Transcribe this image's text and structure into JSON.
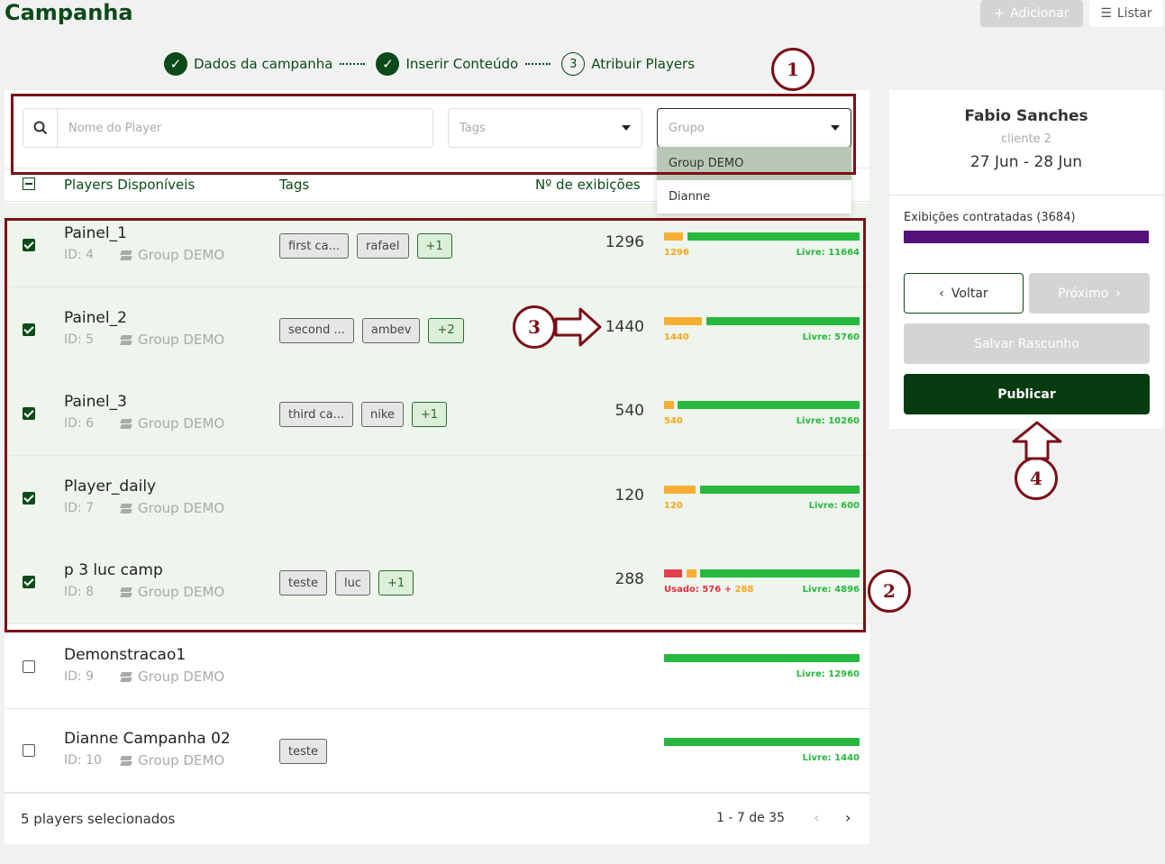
{
  "page_title": "Campanha",
  "top_actions": {
    "add_label": "Adicionar",
    "list_label": "Listar"
  },
  "stepper": [
    {
      "label": "Dados da campanha",
      "state": "done"
    },
    {
      "label": "Inserir Conteúdo",
      "state": "done"
    },
    {
      "label": "Atribuir Players",
      "state": "current",
      "number": "3"
    }
  ],
  "filters": {
    "search_placeholder": "Nome do Player",
    "tags_placeholder": "Tags",
    "group_placeholder": "Grupo",
    "group_options": [
      "Group DEMO",
      "Dianne"
    ]
  },
  "table": {
    "headers": {
      "players": "Players Disponíveis",
      "tags": "Tags",
      "exhibitions": "Nº de exibições"
    },
    "rows": [
      {
        "name": "Painel_1",
        "id": "ID: 4",
        "group": "Group DEMO",
        "tags": [
          "first ca...",
          "rafael"
        ],
        "more": "+1",
        "count": "1296",
        "used_label": "",
        "plus_label": "",
        "sel_label": "1296",
        "free_label": "Livre: 11664",
        "checked": true
      },
      {
        "name": "Painel_2",
        "id": "ID: 5",
        "group": "Group DEMO",
        "tags": [
          "second ...",
          "ambev"
        ],
        "more": "+2",
        "count": "1440",
        "used_label": "",
        "plus_label": "",
        "sel_label": "1440",
        "free_label": "Livre: 5760",
        "checked": true
      },
      {
        "name": "Painel_3",
        "id": "ID: 6",
        "group": "Group DEMO",
        "tags": [
          "third ca...",
          "nike"
        ],
        "more": "+1",
        "count": "540",
        "used_label": "",
        "plus_label": "",
        "sel_label": "540",
        "free_label": "Livre: 10260",
        "checked": true
      },
      {
        "name": "Player_daily",
        "id": "ID: 7",
        "group": "Group DEMO",
        "tags": [],
        "more": "",
        "count": "120",
        "used_label": "",
        "plus_label": "",
        "sel_label": "120",
        "free_label": "Livre: 600",
        "checked": true
      },
      {
        "name": "p 3 luc camp",
        "id": "ID: 8",
        "group": "Group DEMO",
        "tags": [
          "teste",
          "luc"
        ],
        "more": "+1",
        "count": "288",
        "used_label": "Usado: 576",
        "plus_label": "+",
        "sel_label": "288",
        "free_label": "Livre: 4896",
        "checked": true
      },
      {
        "name": "Demonstracao1",
        "id": "ID: 9",
        "group": "Group DEMO",
        "tags": [],
        "more": "",
        "count": "",
        "used_label": "",
        "plus_label": "",
        "sel_label": "",
        "free_label": "Livre: 12960",
        "checked": false
      },
      {
        "name": "Dianne Campanha 02",
        "id": "ID: 10",
        "group": "Group DEMO",
        "tags": [
          "teste"
        ],
        "more": "",
        "count": "",
        "used_label": "",
        "plus_label": "",
        "sel_label": "",
        "free_label": "Livre: 1440",
        "checked": false
      }
    ]
  },
  "footer": {
    "selected_text": "5 players selecionados",
    "pagination": "1 - 7 de 35"
  },
  "summary": {
    "client_name": "Fabio Sanches",
    "client_sub": "cliente 2",
    "date_range": "27 Jun - 28 Jun",
    "contracted_label": "Exibições contratadas (3684)",
    "back_label": "Voltar",
    "next_label": "Próximo",
    "draft_label": "Salvar Rascunho",
    "publish_label": "Publicar"
  },
  "annotations": [
    "1",
    "2",
    "3",
    "4"
  ],
  "colors": {
    "brand_green": "#0b4a1a",
    "annotation": "#7b0f17",
    "bar_used": "#e34050",
    "bar_selected": "#f6ae35",
    "bar_free": "#27b83e",
    "contracted_bar": "#55117a"
  },
  "icons": [
    "plus-icon",
    "list-icon",
    "check-icon",
    "search-icon",
    "caret-down-icon",
    "layers-icon",
    "chevron-left-icon",
    "chevron-right-icon"
  ]
}
